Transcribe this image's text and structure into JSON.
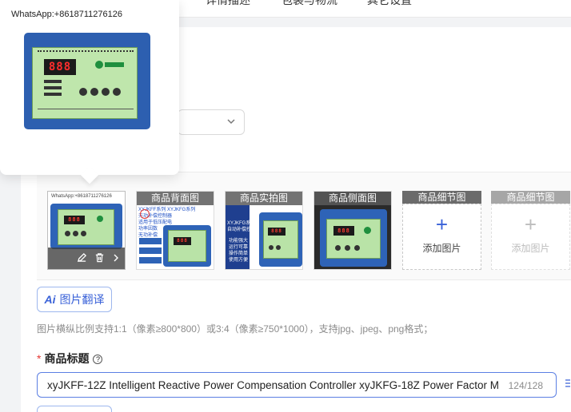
{
  "top_tabs": [
    "详情描述",
    "包装与物流",
    "其它设置"
  ],
  "popup": {
    "watermark": "WhatsApp:+8618711276126"
  },
  "images": {
    "slots": [
      {
        "caption": "",
        "watermark": "WhatsApp:+8618711276126",
        "active": true
      },
      {
        "caption": "商品背面图",
        "lines": [
          "XYJKFF系列  XYJKFG系列",
          "无功补偿控制器",
          "适用于低压配电",
          "功率因数",
          "无功补偿"
        ]
      },
      {
        "caption": "商品实拍图",
        "lines": [
          "XYJKFG系列",
          "自动补偿控制器",
          "功能强大",
          "运行可靠",
          "操作简单",
          "使用方便"
        ]
      },
      {
        "caption": "商品侧面图"
      },
      {
        "caption": "商品细节图",
        "add_label": "添加图片",
        "enabled": true
      },
      {
        "caption": "商品细节图",
        "add_label": "添加图片",
        "enabled": false
      }
    ]
  },
  "ai_translate": {
    "label": "图片翻译",
    "icon": "Ai"
  },
  "hint": "图片横纵比例支持1:1（像素≥800*800）或3:4（像素≥750*1000），支持jpg、jpeg、png格式；",
  "title_field": {
    "label": "商品标题",
    "value": "xyJKFF-12Z Intelligent Reactive Power Compensation Controller xyJKFG-18Z Power Factor M",
    "count": "124/128"
  },
  "colors": {
    "accent": "#3a62d8",
    "device_blue": "#2e63b7",
    "device_face": "#b9e3a7",
    "required": "#e53935"
  }
}
